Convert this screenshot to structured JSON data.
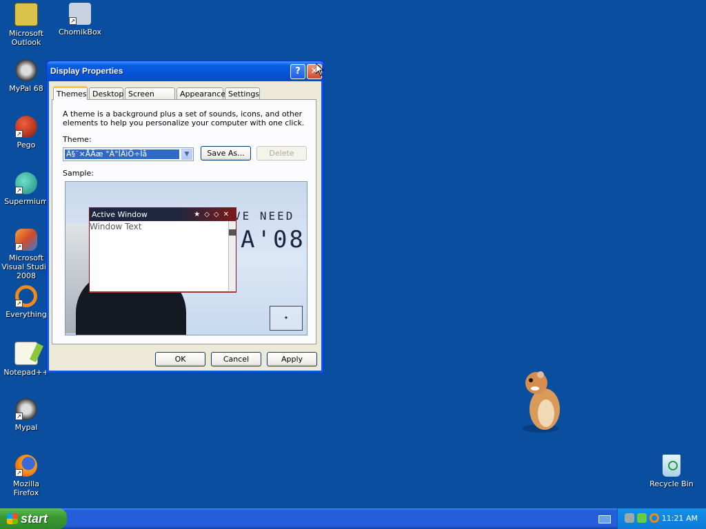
{
  "desktop": {
    "icons": [
      {
        "label": "Microsoft Outlook",
        "icon": "outlook-icon",
        "color": "#d8c24a"
      },
      {
        "label": "ChomikBox",
        "icon": "chomikbox-icon",
        "color": "#c7d1df"
      },
      {
        "label": "MyPal 68",
        "icon": "mypal-raccoon-icon",
        "color": "#4a4a4a"
      },
      {
        "label": "Pego",
        "icon": "pego-icon",
        "color": "#c8341b"
      },
      {
        "label": "Supermium",
        "icon": "supermium-icon",
        "color": "#2fb6a0"
      },
      {
        "label": "Microsoft Visual Studio 2008",
        "icon": "visual-studio-icon",
        "color": "#e06a2c"
      },
      {
        "label": "Everything",
        "icon": "everything-icon",
        "color": "#f08a18"
      },
      {
        "label": "Notepad++",
        "icon": "notepadpp-icon",
        "color": "#8cc63f"
      },
      {
        "label": "Mypal",
        "icon": "mypal-raccoon-icon",
        "color": "#4a4a4a"
      },
      {
        "label": "Mozilla Firefox",
        "icon": "firefox-icon",
        "color": "#e66000"
      },
      {
        "label": "Recycle Bin",
        "icon": "recycle-bin-icon",
        "color": "#c9e3f0"
      }
    ]
  },
  "dialog": {
    "title": "Display Properties",
    "help_glyph": "?",
    "close_glyph": "✕",
    "tabs": [
      {
        "label": "Themes",
        "active": true
      },
      {
        "label": "Desktop",
        "active": false
      },
      {
        "label": "Screen Saver",
        "active": false
      },
      {
        "label": "Appearance",
        "active": false
      },
      {
        "label": "Settings",
        "active": false
      }
    ],
    "description": "A theme is a background plus a set of sounds, icons, and other elements to help you personalize your computer with one click.",
    "theme_label": "Theme:",
    "theme_value": "Ä§¨×ÅÃæ °À°ÌÄìÕ÷Ìå",
    "save_as_label": "Save As...",
    "delete_label": "Delete",
    "sample_label": "Sample:",
    "sample": {
      "poster_line1": "VE NEED",
      "poster_line2": "A'08",
      "active_window_title": "Active Window",
      "window_text": "Window Text"
    },
    "ok_label": "OK",
    "cancel_label": "Cancel",
    "apply_label": "Apply"
  },
  "taskbar": {
    "start_label": "start",
    "clock": "11:21 AM"
  },
  "colors": {
    "desktop_bg": "#0a4ea0",
    "title_bar": "#0a5ee3",
    "dialog_bg": "#ece9d8",
    "selection": "#316ac5"
  }
}
